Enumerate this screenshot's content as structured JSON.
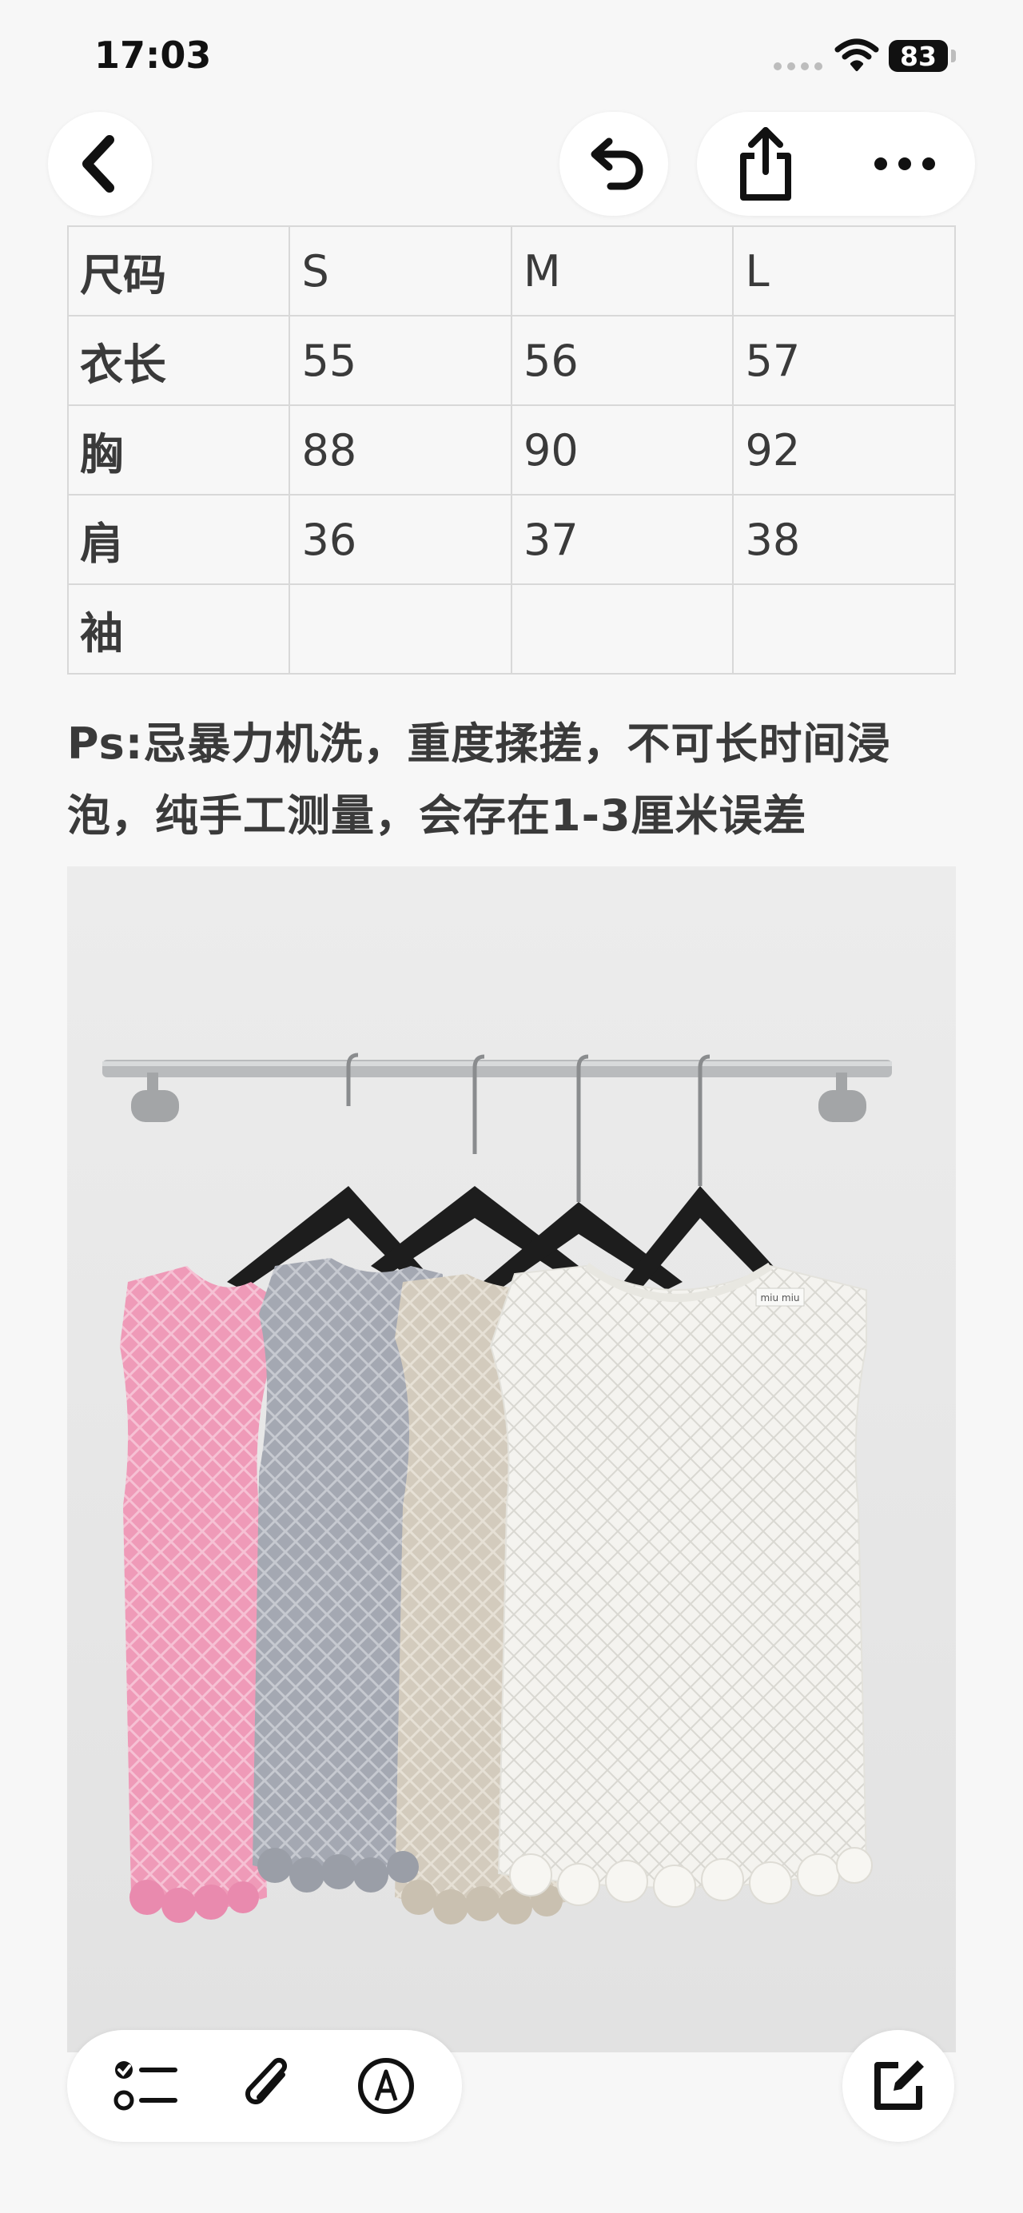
{
  "status": {
    "time": "17:03",
    "battery": "83"
  },
  "table": {
    "rows": [
      [
        "尺码",
        "S",
        "M",
        "L"
      ],
      [
        "衣长",
        "55",
        "56",
        "57"
      ],
      [
        "胸",
        "88",
        "90",
        "92"
      ],
      [
        "肩",
        "36",
        "37",
        "38"
      ],
      [
        "袖",
        "",
        "",
        ""
      ]
    ]
  },
  "note": "Ps:忌暴力机洗，重度揉搓，不可长时间浸泡，纯手工测量，会存在1-3厘米误差",
  "photo": {
    "label_tag": "miu miu"
  },
  "icons": {
    "back": "chevron-left-icon",
    "undo": "undo-icon",
    "share": "share-icon",
    "more": "more-icon",
    "checklist": "checklist-icon",
    "attach": "paperclip-icon",
    "markup": "markup-pen-icon",
    "compose": "compose-icon"
  }
}
